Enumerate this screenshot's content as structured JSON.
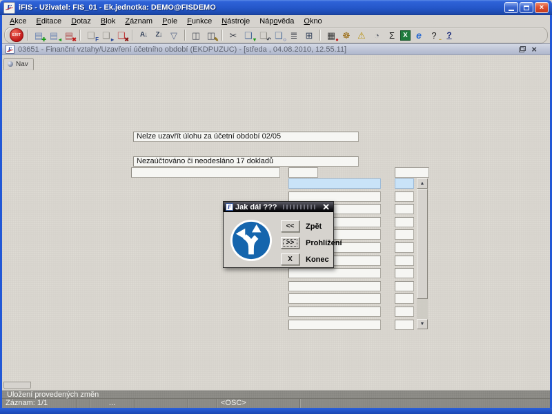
{
  "window": {
    "title": "iFIS - Uživatel: FIS_01 - Ek.jednotka: DEMO@FISDEMO"
  },
  "menu": {
    "items": [
      {
        "label": "Akce",
        "u": 0
      },
      {
        "label": "Editace",
        "u": 0
      },
      {
        "label": "Dotaz",
        "u": 0
      },
      {
        "label": "Blok",
        "u": 0
      },
      {
        "label": "Záznam",
        "u": 0
      },
      {
        "label": "Pole",
        "u": 0
      },
      {
        "label": "Funkce",
        "u": 0
      },
      {
        "label": "Nástroje",
        "u": 0
      },
      {
        "label": "Nápověda",
        "u": 3
      },
      {
        "label": "Okno",
        "u": 0
      }
    ]
  },
  "toolbar": {
    "icons": [
      {
        "type": "exit",
        "name": "exit-button",
        "label": "EXIT"
      },
      {
        "type": "sep"
      },
      {
        "name": "insert-record-icon",
        "glyph": "▤",
        "color": "#7189b4",
        "badge": "✚",
        "badge_color": "#169a16"
      },
      {
        "name": "save-record-icon",
        "glyph": "▤",
        "color": "#7189b4",
        "badge": "◂",
        "badge_color": "#169a16"
      },
      {
        "name": "delete-record-icon",
        "glyph": "▤",
        "color": "#b05050",
        "badge": "✖",
        "badge_color": "#c01818"
      },
      {
        "type": "sep"
      },
      {
        "name": "enter-query-icon",
        "glyph": "❏",
        "color": "#8f8d86",
        "badge": "F",
        "badge_color": "#2a4a9a"
      },
      {
        "name": "execute-query-icon",
        "glyph": "❏",
        "color": "#8f8d86",
        "badge": "▸",
        "badge_color": "#2a4a9a"
      },
      {
        "name": "cancel-query-icon",
        "glyph": "❏",
        "color": "#c03a3a",
        "badge": "✖",
        "badge_color": "#8a1010"
      },
      {
        "type": "sep"
      },
      {
        "name": "sort-asc-icon",
        "glyph": "A↓",
        "color": "#33415a",
        "cls": "sort"
      },
      {
        "name": "sort-desc-icon",
        "glyph": "Z↓",
        "color": "#33415a",
        "cls": "sort"
      },
      {
        "name": "filter-icon",
        "glyph": "▽",
        "color": "#5a6a8a"
      },
      {
        "type": "sep"
      },
      {
        "name": "print-icon",
        "glyph": "◫",
        "color": "#4a4e58"
      },
      {
        "name": "print-setup-icon",
        "glyph": "◫",
        "color": "#4a4e58",
        "badge": "✎",
        "badge_color": "#8a6a10"
      },
      {
        "type": "sep"
      },
      {
        "name": "cut-icon",
        "glyph": "✂",
        "color": "#3a3e48"
      },
      {
        "name": "copy-record-icon",
        "glyph": "❏",
        "color": "#4a6a9a",
        "badge": "▾",
        "badge_color": "#169a16"
      },
      {
        "name": "paste-record-icon",
        "glyph": "❏",
        "color": "#8f8d86",
        "badge": "↶",
        "badge_color": "#3a3e48"
      },
      {
        "name": "preview-icon",
        "glyph": "❏",
        "color": "#4a6a9a",
        "badge": "○",
        "badge_color": "#1a3a9e"
      },
      {
        "name": "list-values-icon",
        "glyph": "≣",
        "color": "#3a3e48"
      },
      {
        "name": "tree-navigator-icon",
        "glyph": "⊞",
        "color": "#33415a"
      },
      {
        "type": "sep"
      },
      {
        "name": "journal-icon",
        "glyph": "▦",
        "color": "#3a3a3a",
        "badge": "●",
        "badge_color": "#c02020"
      },
      {
        "name": "navigation-helm-icon",
        "glyph": "☸",
        "color": "#9a6a10"
      },
      {
        "name": "warning-icon",
        "glyph": "⚠",
        "color": "#b8900a"
      },
      {
        "name": "clock-icon",
        "glyph": "◔",
        "color": "#6a6e78"
      },
      {
        "name": "sum-icon",
        "glyph": "Σ",
        "color": "#111111"
      },
      {
        "type": "excel",
        "name": "excel-export-icon",
        "glyph": "X"
      },
      {
        "name": "browser-icon",
        "glyph": "e",
        "color": "#2a6ad0",
        "cls": "ie"
      },
      {
        "name": "context-help-icon",
        "glyph": "?",
        "color": "#1a1a1a",
        "badge": "∙∙",
        "badge_color": "#b8900a"
      },
      {
        "name": "help-icon",
        "glyph": "?",
        "color": "#1a2a7a",
        "cls": "help-u"
      }
    ]
  },
  "mdi": {
    "title": "03651 - Finanční vztahy/Uzavření účetního období (EKDPUZUC) - [středa , 04.08.2010, 12.55.11]"
  },
  "nav_tab": {
    "label": "Nav"
  },
  "messages": {
    "line1": "Nelze uzavřít úlohu za účetní období 02/05",
    "line2": "Nezaúčtováno či neodesláno 17 dokladů"
  },
  "table": {
    "row_count": 12,
    "selected_index": 0,
    "cell_values_main": [
      "",
      "",
      "",
      "",
      "",
      "",
      "",
      "",
      "",
      "",
      "",
      ""
    ],
    "cell_values_right": [
      "",
      "",
      "",
      "",
      "",
      "",
      "",
      "",
      "",
      "",
      "",
      ""
    ]
  },
  "dialog": {
    "title": "Jak dál ???",
    "sign_color": "#1565ad",
    "buttons": [
      {
        "glyph": "<<",
        "label": "Zpět",
        "focused": false
      },
      {
        "glyph": ">>",
        "label": "Prohlížení",
        "focused": true
      },
      {
        "glyph": "X",
        "label": "Konec",
        "focused": false
      }
    ]
  },
  "status": {
    "message": "Uložení provedených změn",
    "cells": [
      "Záznam: 1/1",
      "",
      "...",
      "",
      "",
      "<OSC>",
      ""
    ]
  },
  "colors": {
    "titlebar_blue": "#2456c8",
    "close_red": "#dd5232",
    "selection_blue": "#c9e3f8",
    "content_gray": "#d4d1ca",
    "status_gray": "#8f8e89",
    "dialog_title_dark": "#14141a"
  }
}
